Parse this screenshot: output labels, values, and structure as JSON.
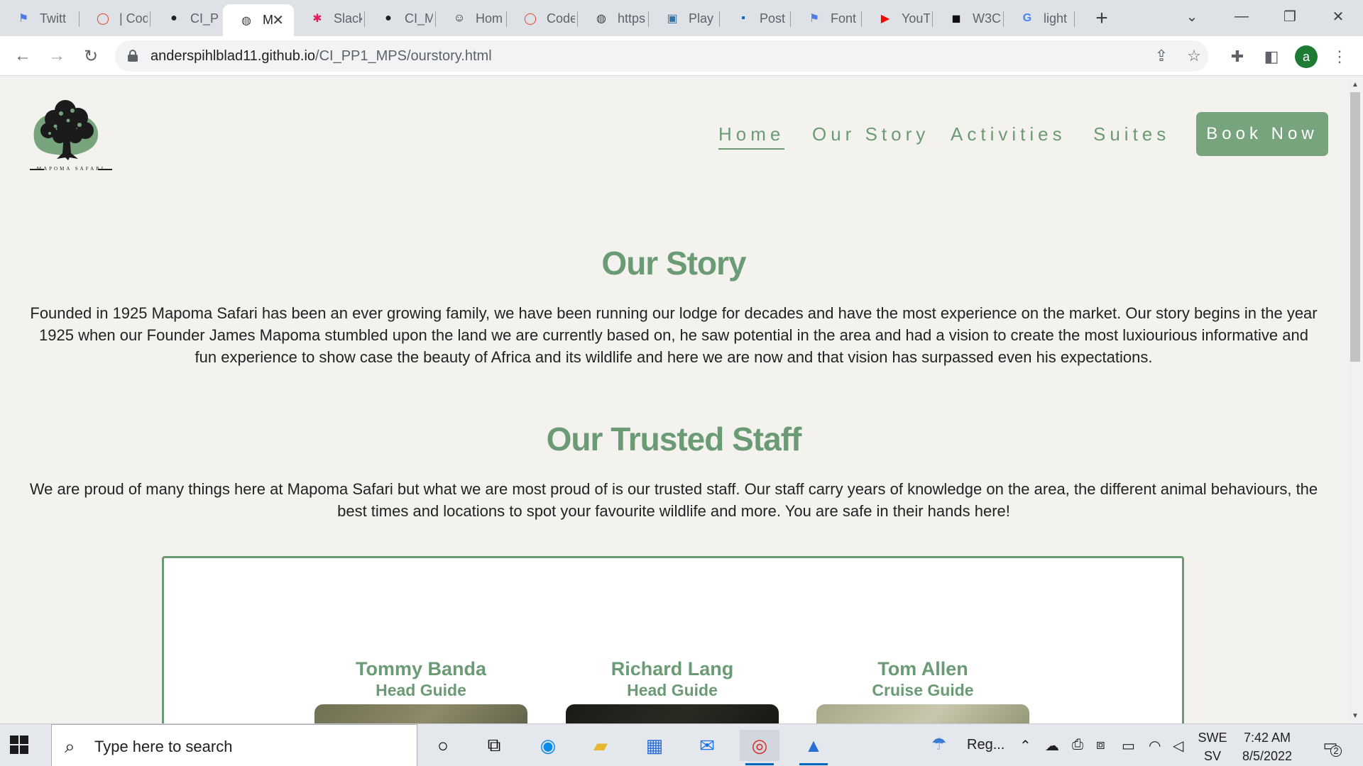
{
  "browser": {
    "tabs": [
      {
        "title": "Twitt",
        "icon": "flag-icon",
        "color": "#4a7be6"
      },
      {
        "title": "| Cod",
        "icon": "codewars-icon",
        "color": "#e04c2f"
      },
      {
        "title": "CI_PF",
        "icon": "github-icon",
        "color": "#202124"
      },
      {
        "title": "M",
        "icon": "globe-icon",
        "color": "#3c4043",
        "active": true
      },
      {
        "title": "Slack",
        "icon": "slack-icon",
        "color": "#e01e5a"
      },
      {
        "title": "CI_M",
        "icon": "github-icon",
        "color": "#202124"
      },
      {
        "title": "Hom",
        "icon": "smiley-icon",
        "color": "#202124"
      },
      {
        "title": "Code",
        "icon": "codewars-icon",
        "color": "#e04c2f"
      },
      {
        "title": "https",
        "icon": "globe-icon",
        "color": "#3c4043"
      },
      {
        "title": "Play",
        "icon": "python-icon",
        "color": "#3572a5"
      },
      {
        "title": "Post",
        "icon": "linkedin-icon",
        "color": "#0a66c2"
      },
      {
        "title": "Font",
        "icon": "flag-icon",
        "color": "#4a7be6"
      },
      {
        "title": "YouT",
        "icon": "youtube-icon",
        "color": "#ff0000"
      },
      {
        "title": "W3C",
        "icon": "w3c-icon",
        "color": "#111111"
      },
      {
        "title": "light",
        "icon": "google-icon",
        "color": "#4285f4"
      }
    ],
    "url_host": "anderspihlblad11.github.io",
    "url_path": "/CI_PP1_MPS/ourstory.html",
    "profile_initial": "a"
  },
  "site": {
    "logo_text": "MAPOMA SAFARI",
    "nav": {
      "home": "Home",
      "our_story": "Our Story",
      "activities": "Activities",
      "suites": "Suites",
      "book_now": "Book Now"
    },
    "our_story": {
      "heading": "Our Story",
      "body": "Founded in 1925 Mapoma Safari has been an ever growing family, we have been running our lodge for decades and have the most experience on the market. Our story begins in the year 1925 when our Founder James Mapoma stumbled upon the land we are currently based on, he saw potential in the area and had a vision to create the most luxiourious informative and fun experience to show case the beauty of Africa and its wildlife and here we are now and that vision has surpassed even his expectations."
    },
    "staff": {
      "heading": "Our Trusted Staff",
      "body": "We are proud of many things here at Mapoma Safari but what we are most proud of is our trusted staff. Our staff carry years of knowledge on the area, the different animal behaviours, the best times and locations to spot your favourite wildlife and more. You are safe in their hands here!",
      "members": [
        {
          "name": "Tommy Banda",
          "role": "Head Guide"
        },
        {
          "name": "Richard Lang",
          "role": "Head Guide"
        },
        {
          "name": "Tom Allen",
          "role": "Cruise Guide"
        }
      ]
    },
    "accent_color": "#6b9b74"
  },
  "taskbar": {
    "search_placeholder": "Type here to search",
    "weather": "Reg...",
    "lang_top": "SWE",
    "lang_bottom": "SV",
    "time": "7:42 AM",
    "date": "8/5/2022",
    "notification_count": "2"
  }
}
